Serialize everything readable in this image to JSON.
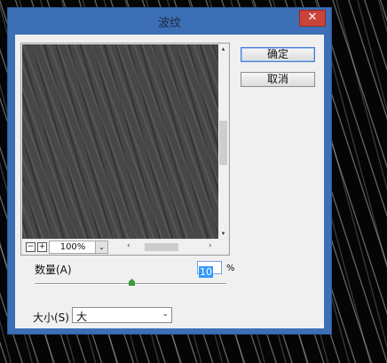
{
  "window": {
    "title": "波纹",
    "close_glyph": "✕"
  },
  "preview": {
    "zoom_out": "−",
    "zoom_in": "+",
    "zoom_value": "100%",
    "zoom_drop_glyph": "⌄",
    "scroll_up": "▴",
    "scroll_down": "▾",
    "scroll_left": "‹",
    "scroll_right": "›"
  },
  "buttons": {
    "ok": "确定",
    "cancel": "取消"
  },
  "amount": {
    "label": "数量(A)",
    "value": "10",
    "unit": "%"
  },
  "size": {
    "label": "大小(S)",
    "selected": "大",
    "chev": "⌄"
  },
  "colors": {
    "title_bar": "#3c6fb5",
    "close_button": "#c9433a",
    "slider_thumb": "#3a9a3a",
    "selection": "#3399ff"
  }
}
